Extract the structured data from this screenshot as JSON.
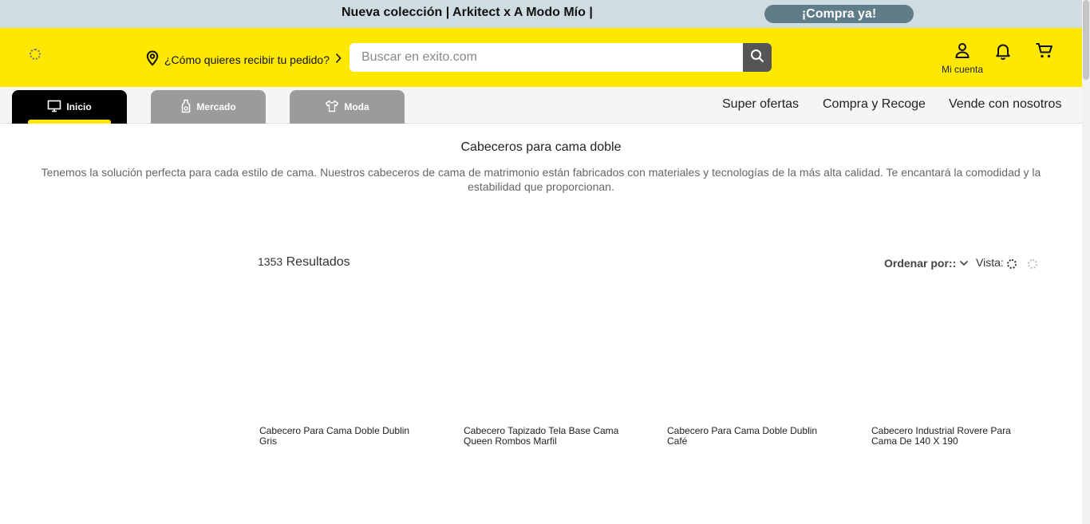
{
  "promo": {
    "text": "Nueva colección | Arkitect x A Modo Mío |",
    "cta": "¡Compra ya!"
  },
  "header": {
    "delivery_text": "¿Cómo quieres recibir tu pedido?",
    "search_placeholder": "Buscar en exito.com",
    "account_label": "Mi cuenta",
    "icons": [
      "location-pin-icon",
      "chevron-right-icon",
      "search-icon",
      "user-icon",
      "bell-icon",
      "cart-icon"
    ]
  },
  "nav": {
    "tabs": [
      {
        "label": "Inicio",
        "icon": "monitor-icon",
        "active": true
      },
      {
        "label": "Mercado",
        "icon": "bottle-icon",
        "active": false
      },
      {
        "label": "Moda",
        "icon": "shirt-icon",
        "active": false
      }
    ],
    "links": [
      "Super ofertas",
      "Compra y Recoge",
      "Vende con nosotros"
    ]
  },
  "category": {
    "title": "Cabeceros para cama doble",
    "description": "Tenemos la solución perfecta para cada estilo de cama. Nuestros cabeceros de cama de matrimonio están fabricados con materiales y tecnologías de la más alta calidad. Te encantará la comodidad y la estabilidad que proporcionan."
  },
  "results": {
    "count": "1353",
    "label": "Resultados",
    "sort_label": "Ordenar por::",
    "view_label": "Vista:"
  },
  "products": [
    {
      "name": "Cabecero Para Cama Doble Dublin Gris"
    },
    {
      "name": "Cabecero Tapizado Tela Base Cama Queen Rombos Marfil"
    },
    {
      "name": "Cabecero Para Cama Doble Dublin Café"
    },
    {
      "name": "Cabecero Industrial Rovere Para Cama De 140 X 190"
    }
  ],
  "colors": {
    "brand_yellow": "#ffe800",
    "promo_bg": "#cfdde3",
    "promo_button": "#5e7d88",
    "tab_active": "#000000",
    "tab_inactive": "#9b9b9b"
  }
}
